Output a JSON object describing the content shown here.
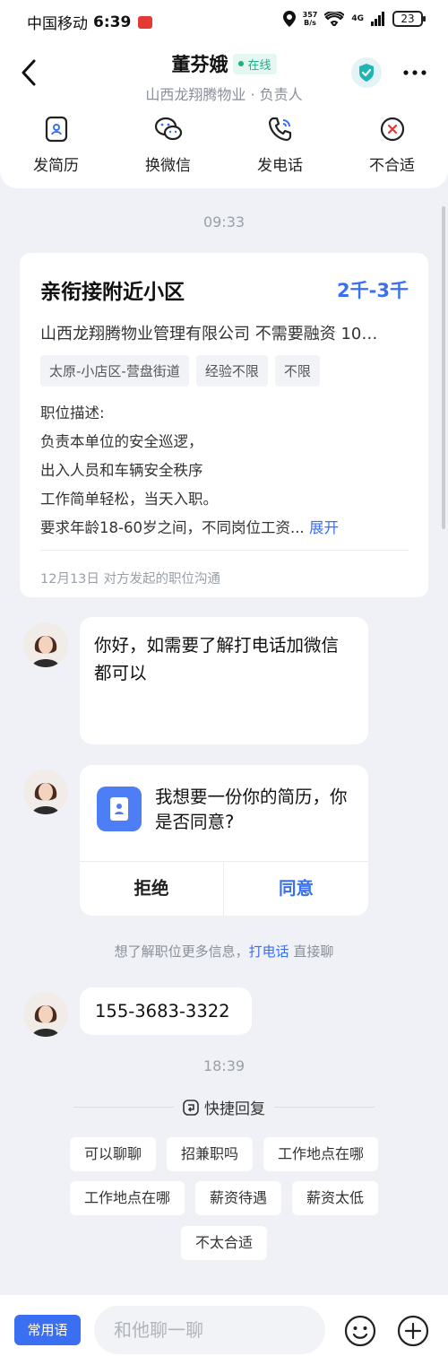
{
  "status_bar": {
    "carrier": "中国移动",
    "time": "6:39",
    "speed_value": "357",
    "speed_unit": "B/s",
    "network": "4G",
    "battery": "23"
  },
  "header": {
    "name": "董芬娥",
    "online_label": "在线",
    "subtitle": "山西龙翔腾物业 · 负责人"
  },
  "actions": [
    {
      "label": "发简历",
      "icon": "resume-icon"
    },
    {
      "label": "换微信",
      "icon": "wechat-icon"
    },
    {
      "label": "发电话",
      "icon": "phone-icon"
    },
    {
      "label": "不合适",
      "icon": "close-circle-icon"
    }
  ],
  "timestamps": {
    "first": "09:33",
    "second": "18:39"
  },
  "job": {
    "title": "亲衔接附近小区",
    "salary": "2千-3千",
    "company": "山西龙翔腾物业管理有限公司 不需要融资 10…",
    "tags": [
      "太原-小店区-营盘街道",
      "经验不限",
      "不限"
    ],
    "description_lines": [
      "职位描述:",
      "负责本单位的安全巡逻，",
      "出入人员和车辆安全秩序",
      "工作简单轻松，当天入职。",
      "要求年龄18-60岁之间，不同岗位工资..."
    ],
    "expand_label": "展开",
    "footnote": "12月13日 对方发起的职位沟通"
  },
  "messages": {
    "greeting": "你好，如需要了解打电话加微信都可以",
    "resume_request": "我想要一份你的简历，你是否同意?",
    "reject_label": "拒绝",
    "agree_label": "同意",
    "call_tip_prefix": "想了解职位更多信息，",
    "call_tip_link": "打电话",
    "call_tip_suffix": " 直接聊",
    "phone_number": "155-3683-3322"
  },
  "quick_reply": {
    "title": "快捷回复",
    "rows": [
      [
        "可以聊聊",
        "招兼职吗",
        "工作地点在哪"
      ],
      [
        "工作地点在哪",
        "薪资待遇",
        "薪资太低"
      ],
      [
        "不太合适"
      ]
    ]
  },
  "input_bar": {
    "phrase_button": "常用语",
    "placeholder": "和他聊一聊"
  },
  "colors": {
    "accent": "#3a6ff2",
    "online": "#1fae86",
    "background": "#eff1f6"
  }
}
